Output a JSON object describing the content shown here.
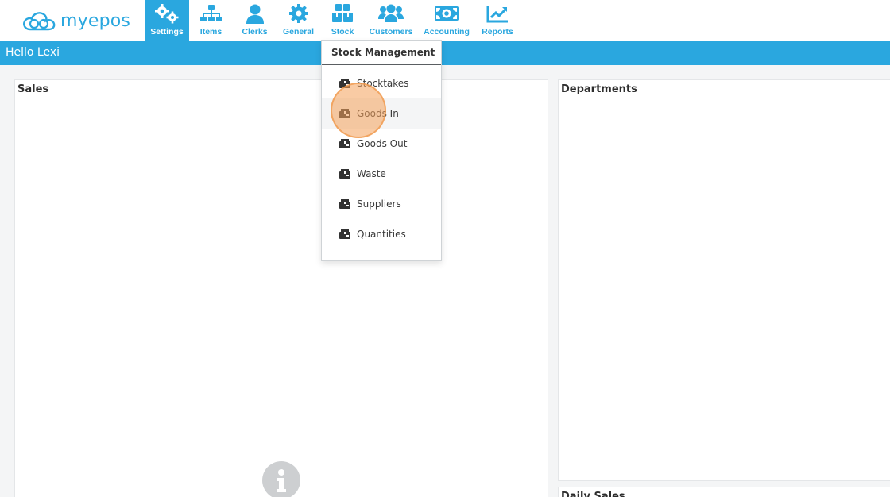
{
  "header": {
    "logo_text": "myepos",
    "nav": [
      {
        "label": "Settings",
        "icon": "gears-icon",
        "active": true
      },
      {
        "label": "Items",
        "icon": "sitemap-icon",
        "active": false
      },
      {
        "label": "Clerks",
        "icon": "user-icon",
        "active": false
      },
      {
        "label": "General",
        "icon": "gear-icon",
        "active": false
      },
      {
        "label": "Stock",
        "icon": "boxes-icon",
        "active": false
      },
      {
        "label": "Customers",
        "icon": "users-icon",
        "active": false
      },
      {
        "label": "Accounting",
        "icon": "money-icon",
        "active": false
      },
      {
        "label": "Reports",
        "icon": "chart-line-icon",
        "active": false
      }
    ],
    "accent_color": "#2aa7df"
  },
  "greeting": "Hello Lexi",
  "panels": {
    "sales_title": "Sales",
    "departments_title": "Departments",
    "daily_sales_title": "Daily Sales"
  },
  "stock_menu": {
    "header": "Stock Management",
    "items": [
      {
        "label": "Stocktakes",
        "icon": "box-icon"
      },
      {
        "label": "Goods In",
        "icon": "box-icon",
        "hovered": true
      },
      {
        "label": "Goods Out",
        "icon": "box-icon"
      },
      {
        "label": "Waste",
        "icon": "box-icon"
      },
      {
        "label": "Suppliers",
        "icon": "box-icon"
      },
      {
        "label": "Quantities",
        "icon": "box-icon"
      }
    ]
  }
}
